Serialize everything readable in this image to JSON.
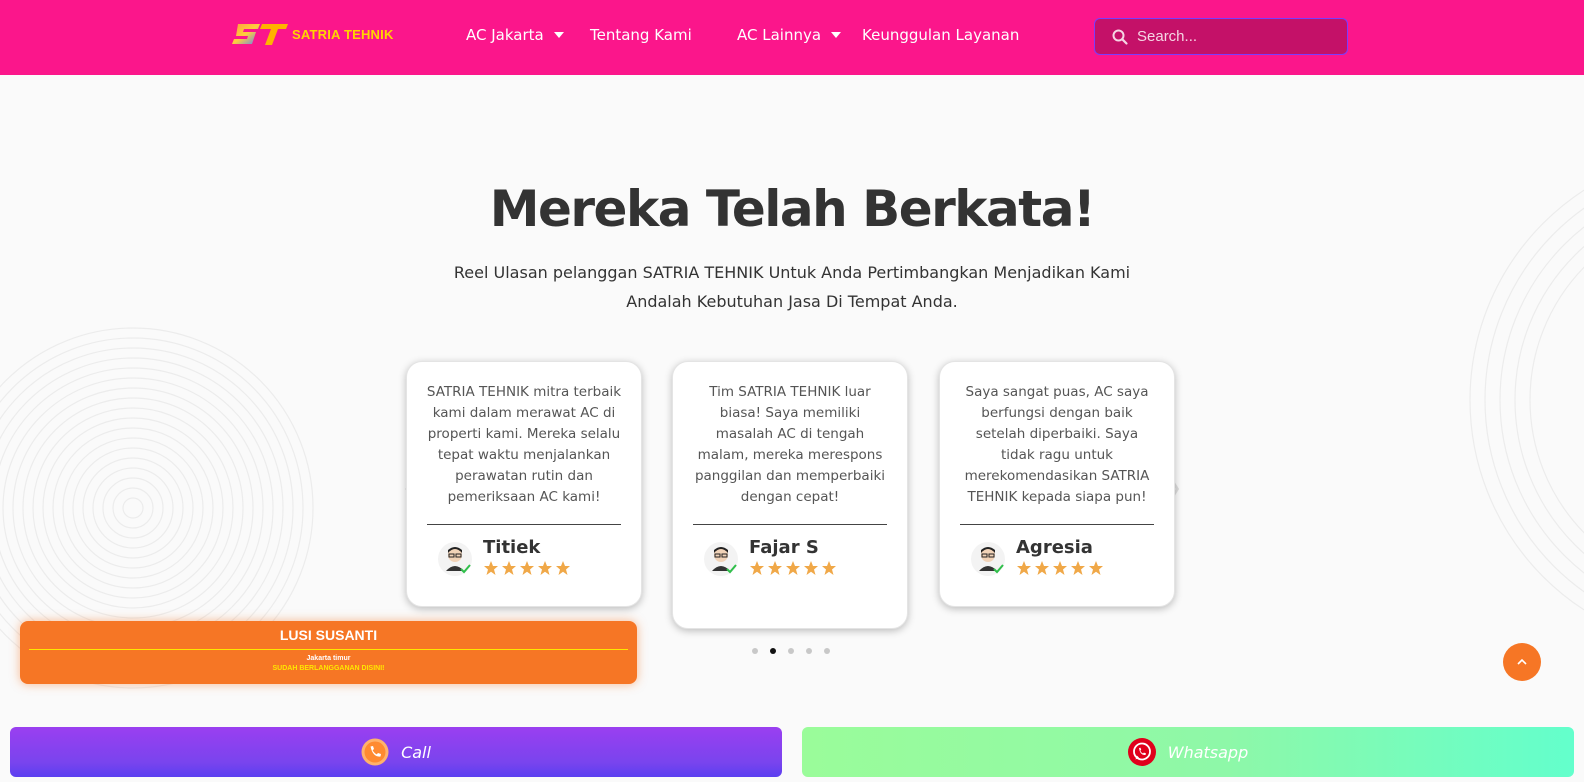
{
  "header": {
    "logo_text": "SATRIA TEHNIK",
    "nav": [
      {
        "label": "AC Jakarta",
        "has_dropdown": true
      },
      {
        "label": "Tentang Kami",
        "has_dropdown": false
      },
      {
        "label": "AC Lainnya",
        "has_dropdown": true
      },
      {
        "label": "Keunggulan Layanan",
        "has_dropdown": false
      }
    ],
    "search_placeholder": "Search..."
  },
  "section": {
    "title": "Mereka Telah Berkata!",
    "subtitle": "Reel Ulasan pelanggan SATRIA TEHNIK Untuk Anda Pertimbangkan Menjadikan Kami Andalah Kebutuhan Jasa Di Tempat Anda."
  },
  "testimonials": [
    {
      "text": "SATRIA TEHNIK mitra terbaik kami dalam merawat AC di properti kami. Mereka selalu tepat waktu menjalankan perawatan rutin dan pemeriksaan AC kami!",
      "name": "Titiek",
      "rating": 5
    },
    {
      "text": "Tim SATRIA TEHNIK luar biasa! Saya memiliki masalah AC di tengah malam, mereka merespons panggilan dan memperbaiki dengan cepat!",
      "name": "Fajar S",
      "rating": 5
    },
    {
      "text": "Saya sangat puas, AC saya berfungsi dengan baik setelah diperbaiki. Saya tidak ragu untuk merekomendasikan SATRIA TEHNIK kepada siapa pun!",
      "name": "Agresia",
      "rating": 5
    }
  ],
  "carousel": {
    "total_dots": 5,
    "active_dot": 2
  },
  "popup": {
    "name": "LUSI SUSANTI",
    "location": "Jakarta timur",
    "cta": "SUDAH BERLANGGANAN DISINI!"
  },
  "bottom_bar": {
    "call_label": "Call",
    "whatsapp_label": "Whatsapp"
  },
  "colors": {
    "header_bg": "#fb168b",
    "accent_orange": "#f67625",
    "star": "#f0a848"
  },
  "icons": {
    "search": "search-icon",
    "scroll_top": "chevron-up-icon",
    "call": "phone-icon",
    "whatsapp": "whatsapp-icon"
  }
}
